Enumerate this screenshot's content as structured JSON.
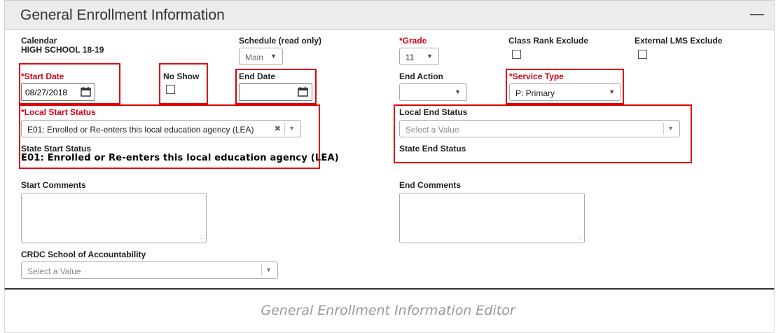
{
  "panel": {
    "title": "General Enrollment Information",
    "collapse_icon": "minus-icon"
  },
  "calendar": {
    "label": "Calendar",
    "value": "HIGH SCHOOL 18-19"
  },
  "schedule": {
    "label": "Schedule (read only)",
    "value": "Main"
  },
  "grade": {
    "required_mark": "*",
    "label": "Grade",
    "value": "11"
  },
  "class_rank_exclude": {
    "label": "Class Rank Exclude",
    "checked": false
  },
  "external_lms_exclude": {
    "label": "External LMS Exclude",
    "checked": false
  },
  "start_date": {
    "required_mark": "*",
    "label": "Start Date",
    "value": "08/27/2018"
  },
  "no_show": {
    "label": "No Show",
    "checked": false
  },
  "end_date": {
    "label": "End Date",
    "value": ""
  },
  "end_action": {
    "label": "End Action",
    "value": ""
  },
  "service_type": {
    "required_mark": "*",
    "label": "Service Type",
    "value": "P: Primary"
  },
  "local_start_status": {
    "required_mark": "*",
    "label": "Local Start Status",
    "value": "E01: Enrolled or Re-enters this local education agency (LEA)",
    "clear_glyph": "✖"
  },
  "state_start_status": {
    "label": "State Start Status",
    "value": "E01: Enrolled or Re-enters this local education agency (LEA)"
  },
  "local_end_status": {
    "label": "Local End Status",
    "placeholder": "Select a Value"
  },
  "state_end_status": {
    "label": "State End Status"
  },
  "start_comments": {
    "label": "Start Comments",
    "value": ""
  },
  "end_comments": {
    "label": "End Comments",
    "value": ""
  },
  "crdc": {
    "label": "CRDC School of Accountability",
    "placeholder": "Select a Value"
  },
  "caption": "General Enrollment Information Editor",
  "colors": {
    "required": "#d0021b",
    "highlight": "#e00000",
    "header_bg": "#ececec"
  }
}
